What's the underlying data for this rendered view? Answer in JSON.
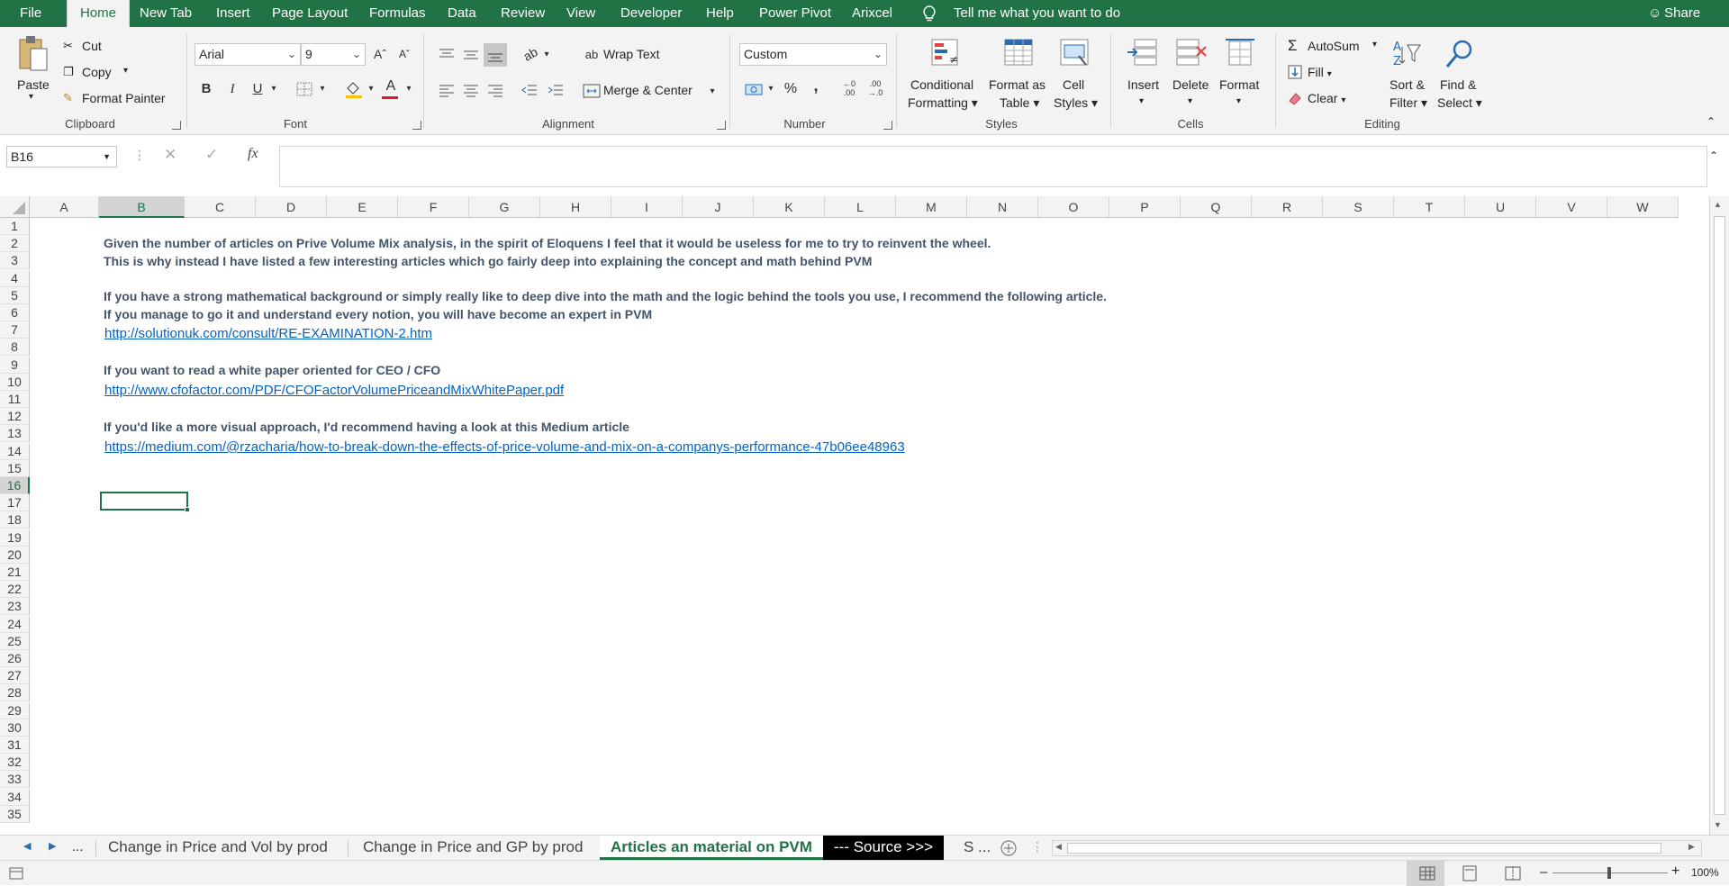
{
  "menu": {
    "file": "File",
    "tabs": [
      "Home",
      "New Tab",
      "Insert",
      "Page Layout",
      "Formulas",
      "Data",
      "Review",
      "View",
      "Developer",
      "Help",
      "Power Pivot",
      "Arixcel"
    ],
    "tell_me": "Tell me what you want to do",
    "share": "Share"
  },
  "ribbon": {
    "clipboard": {
      "paste": "Paste",
      "cut": "Cut",
      "copy": "Copy",
      "format_painter": "Format Painter",
      "label": "Clipboard"
    },
    "font": {
      "name": "Arial",
      "size": "9",
      "bold": "B",
      "italic": "I",
      "underline": "U",
      "label": "Font"
    },
    "alignment": {
      "wrap_text": "Wrap Text",
      "merge_center": "Merge & Center",
      "label": "Alignment"
    },
    "number": {
      "format": "Custom",
      "percent": "%",
      "comma": ",",
      "label": "Number"
    },
    "styles": {
      "conditional": "Conditional",
      "conditional2": "Formatting",
      "format_as": "Format as",
      "format_as2": "Table",
      "cell": "Cell",
      "cell2": "Styles",
      "label": "Styles"
    },
    "cells": {
      "insert": "Insert",
      "delete": "Delete",
      "format": "Format",
      "label": "Cells"
    },
    "editing": {
      "autosum": "AutoSum",
      "fill": "Fill",
      "clear": "Clear",
      "sort": "Sort &",
      "sort2": "Filter",
      "find": "Find &",
      "find2": "Select",
      "label": "Editing"
    }
  },
  "formula_bar": {
    "name_box": "B16",
    "fx": "fx",
    "value": ""
  },
  "grid": {
    "columns": [
      "A",
      "B",
      "C",
      "D",
      "E",
      "F",
      "G",
      "H",
      "I",
      "J",
      "K",
      "L",
      "M",
      "N",
      "O",
      "P",
      "Q",
      "R",
      "S",
      "T",
      "U",
      "V",
      "W"
    ],
    "rows": [
      "1",
      "2",
      "3",
      "4",
      "5",
      "6",
      "7",
      "8",
      "9",
      "10",
      "11",
      "12",
      "13",
      "14",
      "15",
      "16",
      "17",
      "18",
      "19",
      "20",
      "21",
      "22",
      "23",
      "24",
      "25",
      "26",
      "27",
      "28",
      "29",
      "30",
      "31",
      "32",
      "33",
      "34",
      "35"
    ],
    "cells": {
      "r2": "Given the number of articles on Prive Volume Mix analysis, in the spirit of Eloquens I feel that it would be useless for me to try to reinvent the wheel.",
      "r3": "This is why instead I have listed a few interesting articles which go fairly deep into explaining the concept and math behind PVM",
      "r5": "If you have a strong mathematical background or simply really like to deep dive into the math and the logic behind the tools you use, I recommend the following article.",
      "r6": "If you manage to go it and understand every notion, you will have become an expert in PVM",
      "r7": "http://solutionuk.com/consult/RE-EXAMINATION-2.htm",
      "r9": "If you want to read a white paper oriented for CEO / CFO",
      "r10": "http://www.cfofactor.com/PDF/CFOFactorVolumePriceandMixWhitePaper.pdf",
      "r12": "If you'd like a more visual approach, I'd recommend having a look at this Medium article",
      "r13": "https://medium.com/@rzacharia/how-to-break-down-the-effects-of-price-volume-and-mix-on-a-companys-performance-47b06ee48963"
    }
  },
  "sheet_tabs": {
    "ellipsis": "...",
    "tab1": "Change in Price and Vol by prod",
    "tab2": "Change in Price and GP by prod",
    "tab3": "Articles an material on PVM",
    "tab4": "--- Source >>>",
    "tab5": "S ..."
  },
  "status": {
    "zoom": "100%"
  },
  "colors": {
    "excel_green": "#217346",
    "link": "#0563c1",
    "text": "#44546a"
  }
}
